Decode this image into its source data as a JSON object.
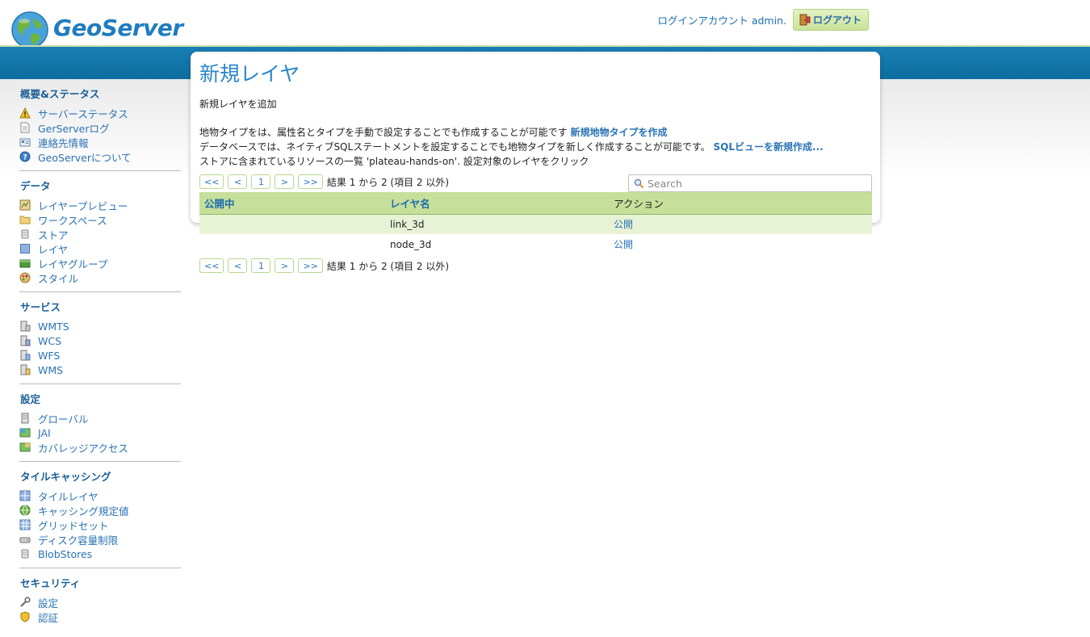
{
  "header": {
    "brand": "GeoServer",
    "login_text": "ログインアカウント admin.",
    "logout_label": "ログアウト"
  },
  "sidebar": {
    "sections": [
      {
        "title": "概要&ステータス",
        "items": [
          "サーバーステータス",
          "GerServerログ",
          "連絡先情報",
          "GeoServerについて"
        ]
      },
      {
        "title": "データ",
        "items": [
          "レイヤープレビュー",
          "ワークスペース",
          "ストア",
          "レイヤ",
          "レイヤグループ",
          "スタイル"
        ]
      },
      {
        "title": "サービス",
        "items": [
          "WMTS",
          "WCS",
          "WFS",
          "WMS"
        ]
      },
      {
        "title": "設定",
        "items": [
          "グローバル",
          "JAI",
          "カバレッジアクセス"
        ]
      },
      {
        "title": "タイルキャッシング",
        "items": [
          "タイルレイヤ",
          "キャッシング規定値",
          "グリッドセット",
          "ディスク容量制限",
          "BlobStores"
        ]
      },
      {
        "title": "セキュリティ",
        "items": [
          "設定",
          "認証"
        ]
      }
    ]
  },
  "main": {
    "title": "新規レイヤ",
    "subtitle": "新規レイヤを追加",
    "line1_text": "地物タイプをは、属性名とタイプを手動で設定することでも作成することが可能です",
    "line1_link": "新規地物タイプを作成",
    "line2_text": "データベースでは、ネイティブSQLステートメントを設定することでも地物タイプを新しく作成することが可能です。",
    "line2_link": "SQLビューを新規作成...",
    "line3_text": "ストアに含まれているリソースの一覧 'plateau-hands-on'. 設定対象のレイヤをクリック",
    "pager": {
      "first": "<<",
      "prev": "<",
      "page": "1",
      "next": ">",
      "last": ">>",
      "summary": "結果 1 から 2 (項目 2 以外)"
    },
    "search_placeholder": "Search",
    "table": {
      "headers": [
        "公開中",
        "レイヤ名",
        "アクション"
      ],
      "rows": [
        {
          "published": "",
          "name": "link_3d",
          "action": "公開"
        },
        {
          "published": "",
          "name": "node_3d",
          "action": "公開"
        }
      ]
    }
  },
  "colors": {
    "accent_blue": "#2a86c8",
    "band_blue": "#0d6e9f",
    "header_green": "#c6df9a",
    "row_green": "#e8f3d5"
  }
}
